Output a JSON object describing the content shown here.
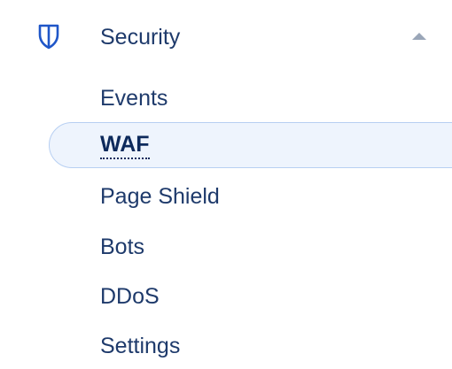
{
  "section": {
    "label": "Security",
    "icon": "shield-icon",
    "expanded": true,
    "chevron_icon": "chevron-up-icon"
  },
  "items": [
    {
      "label": "Events",
      "active": false
    },
    {
      "label": "WAF",
      "active": true
    },
    {
      "label": "Page Shield",
      "active": false
    },
    {
      "label": "Bots",
      "active": false
    },
    {
      "label": "DDoS",
      "active": false
    },
    {
      "label": "Settings",
      "active": false
    }
  ],
  "colors": {
    "text": "#1e3a6b",
    "active_text": "#0d2a5c",
    "active_bg": "#eef4fd",
    "active_border": "#b7cff2",
    "icon": "#1f56c8",
    "chevron": "#9aa6b8"
  }
}
